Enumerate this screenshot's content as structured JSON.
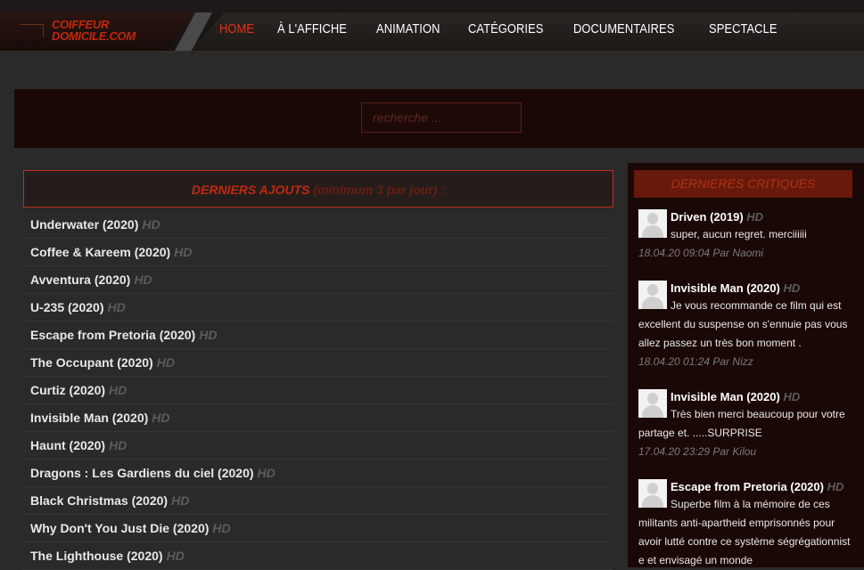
{
  "logo": {
    "line1": "COIFFEUR",
    "line2": "DOMICILE.COM"
  },
  "nav": [
    "HOME",
    "À L'AFFICHE",
    "ANIMATION",
    "CATÉGORIES",
    "DOCUMENTAIRES",
    "SPECTACLE"
  ],
  "search": {
    "placeholder": "recherche ..."
  },
  "main": {
    "header_strong": "DERNIERS AJOUTS",
    "header_note": "(minimum 3 par jour) :",
    "hd_label": "HD",
    "items": [
      "Underwater (2020)",
      "Coffee & Kareem (2020)",
      "Avventura (2020)",
      "U-235 (2020)",
      "Escape from Pretoria (2020)",
      "The Occupant (2020)",
      "Curtiz (2020)",
      "Invisible Man (2020)",
      "Haunt (2020)",
      "Dragons : Les Gardiens du ciel (2020)",
      "Black Christmas (2020)",
      "Why Don't You Just Die (2020)",
      "The Lighthouse (2020)"
    ]
  },
  "sidebar": {
    "title": "DERNIERES CRITIQUES",
    "hd_label": "HD",
    "reviews": [
      {
        "title": "Driven (2019)",
        "text": "super, aucun regret. merciiiiii",
        "meta": "18.04.20 09:04 Par Naomi"
      },
      {
        "title": "Invisible Man (2020)",
        "text": "Je vous recommande ce film qui est excellent du suspense on s'ennuie pas vous allez passez un très bon moment .",
        "meta": "18.04.20 01:24 Par Nizz"
      },
      {
        "title": "Invisible Man (2020)",
        "text": "Très bien merci beaucoup pour votre partage et. .....SURPRISE",
        "meta": "17.04.20 23:29 Par Kilou"
      },
      {
        "title": "Escape from Pretoria (2020)",
        "text": "Superbe film à la mémoire de ces militants anti-apartheid emprisonnés pour avoir lutté contre ce système ségrégationnist e et envisagé un monde",
        "meta": ""
      }
    ]
  },
  "colors": {
    "accent": "#c3290f",
    "band": "#1a0806",
    "bg": "#2a2a2a"
  }
}
